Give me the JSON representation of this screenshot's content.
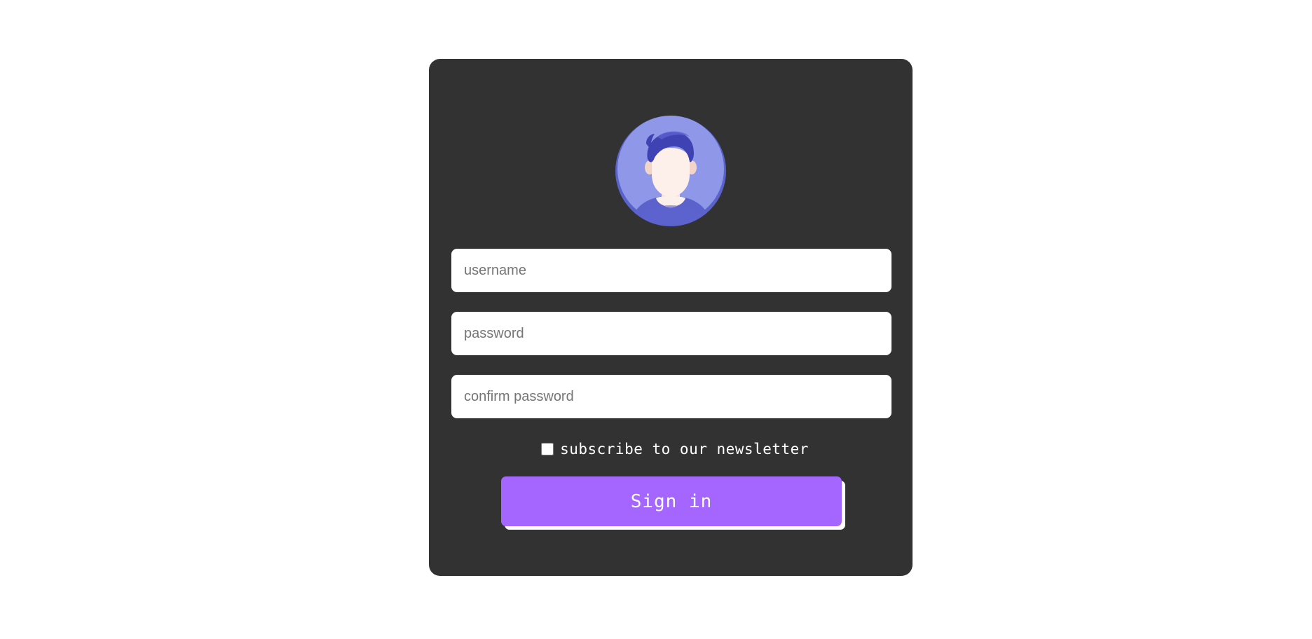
{
  "form": {
    "username_placeholder": "username",
    "password_placeholder": "password",
    "confirm_password_placeholder": "confirm password",
    "newsletter_label": "subscribe to our newsletter",
    "newsletter_checked": false,
    "submit_label": "Sign in"
  },
  "avatar": {
    "icon": "user-avatar-icon"
  },
  "colors": {
    "page_background": "#ffffff",
    "card_background": "#323232",
    "button_accent": "#a466ff",
    "avatar_background": "#8f97e8",
    "avatar_hair": "#3f42b3"
  }
}
